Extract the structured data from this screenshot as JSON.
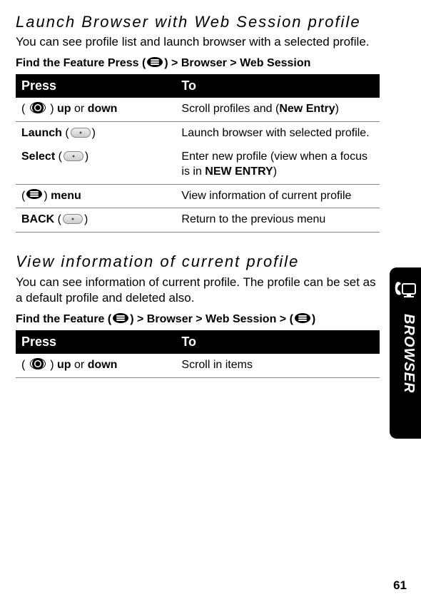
{
  "section1": {
    "title": "Launch Browser with Web Session profile",
    "body": "You can see profile list and launch browser with a selected profile.",
    "feature_prefix": "Find the Feature Press (",
    "feature_suffix": ") > Browser > Web Session",
    "header_press": "Press",
    "header_to": "To",
    "rows": {
      "r0_press_pre": "(",
      "r0_press_mid": ") ",
      "r0_press_updown": "up",
      "r0_press_or": " or ",
      "r0_press_down": "down",
      "r0_to_pre": "Scroll profiles and (",
      "r0_to_bold": "New Entry",
      "r0_to_post": ")",
      "r1a_label": "Launch",
      "r1a_paren_open": " (",
      "r1a_paren_close": ")",
      "r1a_to": "Launch browser with selected profile.",
      "r1b_label": "Select",
      "r1b_paren_open": " (",
      "r1b_paren_close": ")",
      "r1b_to_pre": "Enter new profile (view when a focus is in ",
      "r1b_to_bold": "NEW ENTRY",
      "r1b_to_post": ")",
      "r2_press_pre": "(",
      "r2_press_post": ") ",
      "r2_press_bold": "menu",
      "r2_to": "View information of current profile",
      "r3_label": "BACK",
      "r3_paren_open": " (",
      "r3_paren_close": ")",
      "r3_to": "Return to the previous menu"
    }
  },
  "section2": {
    "title": "View information of current profile",
    "body": "You can see information of current profile. The profile can be set as a default profile and deleted also.",
    "feature_prefix": "Find the Feature (",
    "feature_mid": ") > Browser > Web Session > (",
    "feature_suffix": ")",
    "header_press": "Press",
    "header_to": "To",
    "rows": {
      "r0_press_pre": "(",
      "r0_press_mid": ") ",
      "r0_press_updown": "up",
      "r0_press_or": " or ",
      "r0_press_down": "down",
      "r0_to": "Scroll in items"
    }
  },
  "side_label": "BROWSER",
  "page_number": "61"
}
